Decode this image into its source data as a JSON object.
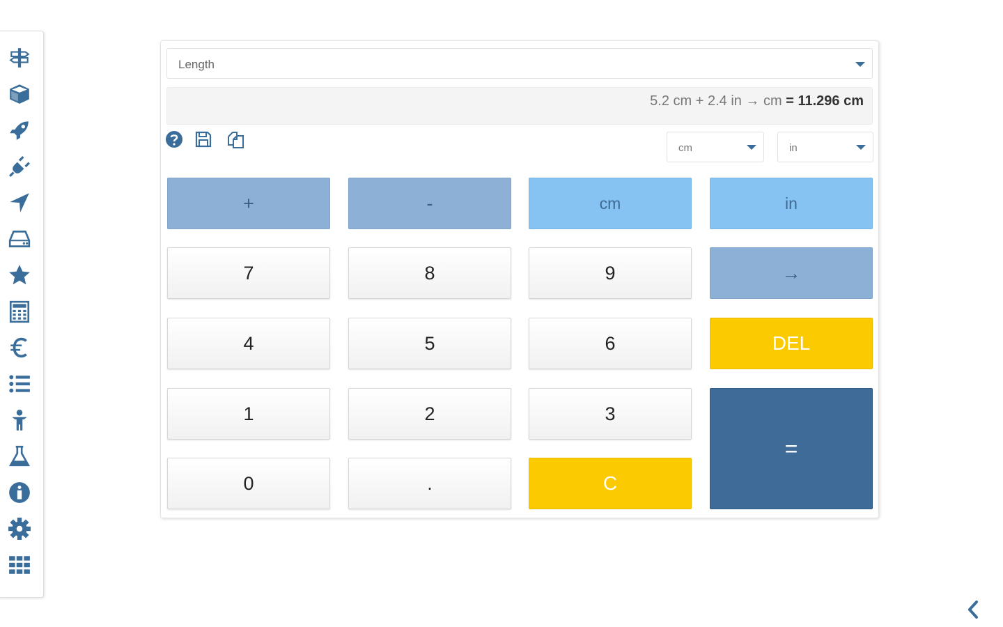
{
  "sidebar": {
    "icons": [
      "signpost-icon",
      "cube-icon",
      "rocket-icon",
      "plug-icon",
      "location-arrow-icon",
      "hard-drive-icon",
      "star-icon",
      "calculator-icon",
      "euro-icon",
      "list-icon",
      "child-icon",
      "flask-icon",
      "info-icon",
      "gear-icon",
      "grid-icon"
    ]
  },
  "converter": {
    "category": "Length",
    "expression": "5.2 cm + 2.4 in → cm",
    "result": "= 11.296 cm",
    "unit_from": "cm",
    "unit_to": "in"
  },
  "toolbar": {
    "icons": [
      "help-icon",
      "save-icon",
      "copy-icon"
    ]
  },
  "keypad": {
    "plus": "+",
    "minus": "-",
    "unit1": "cm",
    "unit2": "in",
    "seven": "7",
    "eight": "8",
    "nine": "9",
    "arrow": "→",
    "four": "4",
    "five": "5",
    "six": "6",
    "del": "DEL",
    "one": "1",
    "two": "2",
    "three": "3",
    "equals": "=",
    "zero": "0",
    "dot": ".",
    "clear": "C"
  },
  "colors": {
    "accent": "#3a6d9a",
    "operator": "#8db1d6",
    "unit_key": "#86c2f2",
    "warning": "#fcca00",
    "equals": "#3e6b97"
  }
}
